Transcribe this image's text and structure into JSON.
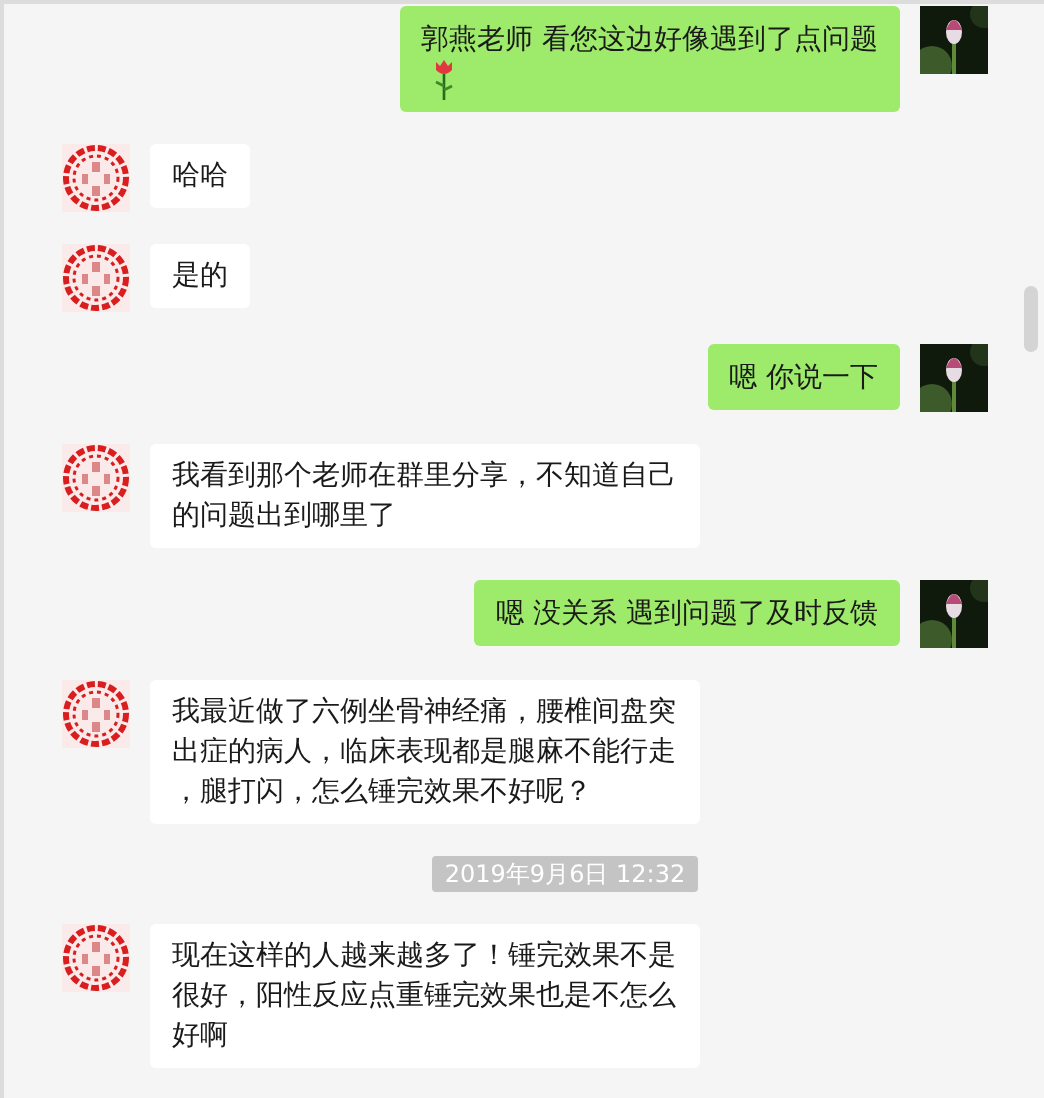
{
  "messages": [
    {
      "kind": "outgoing",
      "text": "郭燕老师  看您这边好像遇到了点问题",
      "trailing_rose": true
    },
    {
      "kind": "incoming",
      "text": "哈哈"
    },
    {
      "kind": "incoming",
      "text": "是的"
    },
    {
      "kind": "outgoing",
      "text": "嗯 你说一下"
    },
    {
      "kind": "incoming",
      "text": "我看到那个老师在群里分享，不知道自己的问题出到哪里了"
    },
    {
      "kind": "outgoing",
      "text": "嗯 没关系  遇到问题了及时反馈"
    },
    {
      "kind": "incoming",
      "text": "我最近做了六例坐骨神经痛，腰椎间盘突出症的病人，临床表现都是腿麻不能行走，腿打闪，怎么锤完效果不好呢？"
    },
    {
      "kind": "time",
      "text": "2019年9月6日 12:32"
    },
    {
      "kind": "incoming",
      "text": "现在这样的人越来越多了！锤完效果不是很好，阳性反应点重锤完效果也是不怎么好啊"
    }
  ]
}
